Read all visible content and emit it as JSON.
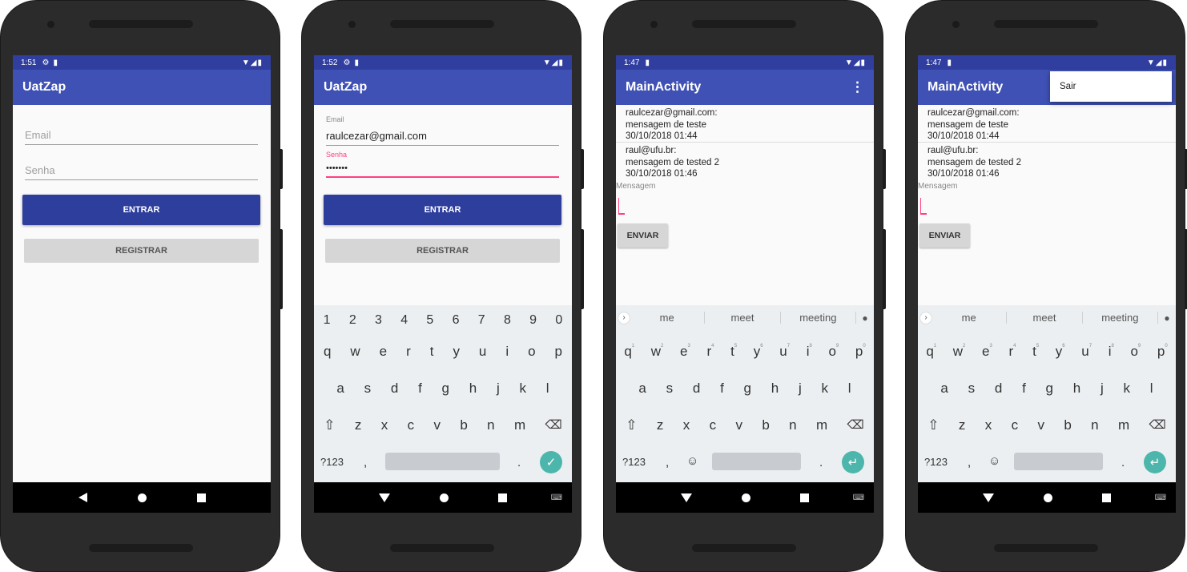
{
  "phones": [
    {
      "status_time": "1:51",
      "app_title": "UatZap",
      "email_placeholder": "Email",
      "senha_placeholder": "Senha",
      "login_button": "ENTRAR",
      "register_button": "REGISTRAR"
    },
    {
      "status_time": "1:52",
      "app_title": "UatZap",
      "email_label": "Email",
      "email_value": "raulcezar@gmail.com",
      "senha_label": "Senha",
      "senha_value": "•••••••",
      "login_button": "ENTRAR",
      "register_button": "REGISTRAR"
    },
    {
      "status_time": "1:47",
      "app_title": "MainActivity",
      "menu_icon": "⋮"
    },
    {
      "status_time": "1:47",
      "app_title": "MainActivity",
      "popup_item": "Sair"
    }
  ],
  "messages": [
    {
      "sender": "raulcezar@gmail.com:",
      "text": "mensagem de teste",
      "time": "30/10/2018 01:44"
    },
    {
      "sender": "raul@ufu.br:",
      "text": "mensagem de tested 2",
      "time": "30/10/2018 01:46"
    }
  ],
  "message_input_label": "Mensagem",
  "send_button": "ENVIAR",
  "keyboard": {
    "numbers": [
      "1",
      "2",
      "3",
      "4",
      "5",
      "6",
      "7",
      "8",
      "9",
      "0"
    ],
    "row1": [
      "q",
      "w",
      "e",
      "r",
      "t",
      "y",
      "u",
      "i",
      "o",
      "p"
    ],
    "row2": [
      "a",
      "s",
      "d",
      "f",
      "g",
      "h",
      "j",
      "k",
      "l"
    ],
    "row3": [
      "z",
      "x",
      "c",
      "v",
      "b",
      "n",
      "m"
    ],
    "symbols_key": "?123",
    "comma": ",",
    "period": ".",
    "suggestions": [
      "me",
      "meet",
      "meeting"
    ]
  },
  "icons": {
    "shift": "⇧",
    "backspace": "⌫",
    "done": "✓",
    "enter": "↵",
    "emoji": "☺",
    "mic": "🎤",
    "chevron": "›",
    "settings": "⚙",
    "sdcard": "▮",
    "wifi": "▼◢▮"
  }
}
